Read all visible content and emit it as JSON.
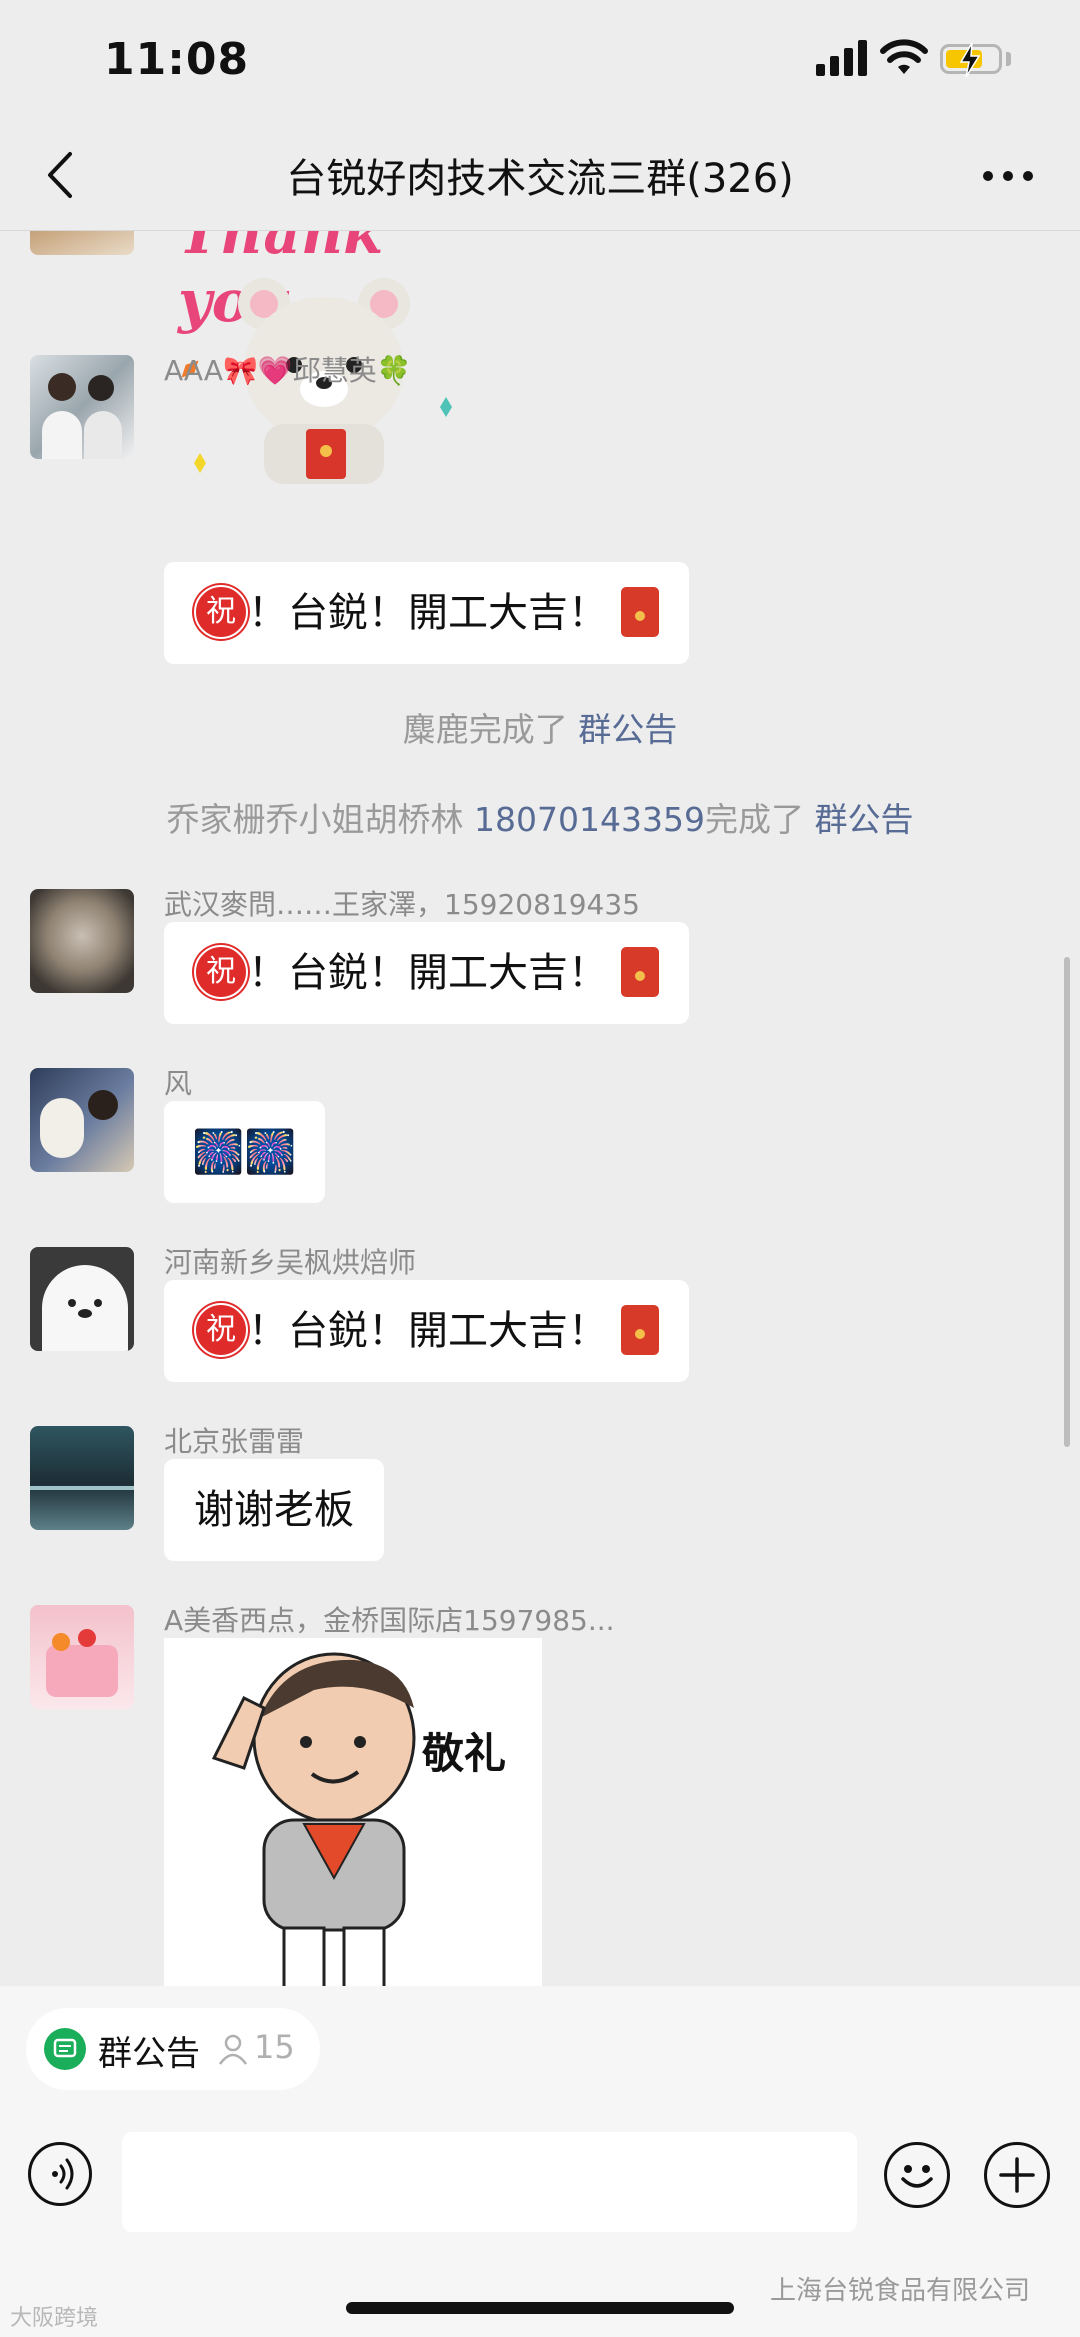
{
  "status_bar": {
    "time": "11:08",
    "battery": "charging"
  },
  "nav": {
    "title": "台锐好肉技术交流三群(326)"
  },
  "stickers": {
    "thankyou_text": "Thank you",
    "salute_caption": "敬礼"
  },
  "messages": [
    {
      "sender": "AAA🎀💗邱慧英🍀",
      "text": "！台鋭！開工大吉！",
      "badge": "祝"
    },
    {
      "sender": "武汉麥問……王家澤，15920819435",
      "text": "！台鋭！開工大吉！",
      "badge": "祝"
    },
    {
      "sender": "风",
      "text": "🎆🎆"
    },
    {
      "sender": "河南新乡吴枫烘焙师",
      "text": "！台鋭！開工大吉！",
      "badge": "祝"
    },
    {
      "sender": "北京张雷雷",
      "text": "谢谢老板"
    },
    {
      "sender": "A美香西点，金桥国际店1597985..."
    }
  ],
  "system": [
    {
      "prefix": "麋鹿完成了 ",
      "link": "群公告"
    },
    {
      "prefix": "乔家栅乔小姐胡桥林 ",
      "phone": "18070143359",
      "middle": "完成了 ",
      "link": "群公告"
    }
  ],
  "notice": {
    "label": "群公告",
    "count": "15"
  },
  "watermark": {
    "right": "上海台锐食品有限公司",
    "left": "大阪跨境"
  }
}
